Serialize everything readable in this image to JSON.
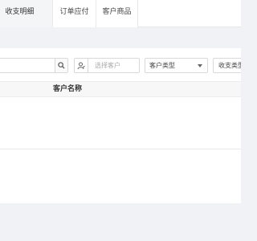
{
  "tabs": [
    {
      "label": "收支明细",
      "active": true
    },
    {
      "label": "订单应付",
      "active": false
    },
    {
      "label": "客户商品",
      "active": false
    }
  ],
  "filters": {
    "search_value": "",
    "customer_placeholder": "选择客户",
    "customer_type_value": "客户类型",
    "income_expense_value": "收支类型"
  },
  "table": {
    "columns": [
      "客户名称"
    ],
    "rows": []
  },
  "icons": {
    "search": "search-icon",
    "customer": "user-icon",
    "dropdown": "caret-down-icon"
  },
  "colors": {
    "background": "#f0f2f5",
    "panel": "#ffffff",
    "border": "#d9d9d9"
  }
}
